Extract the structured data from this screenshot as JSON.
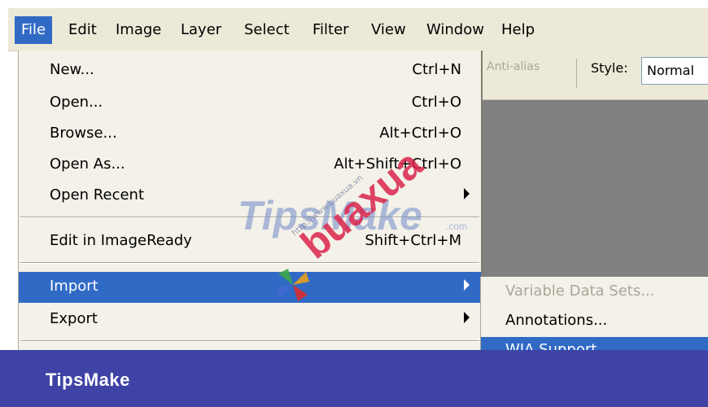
{
  "menubar": {
    "items": [
      "File",
      "Edit",
      "Image",
      "Layer",
      "Select",
      "Filter",
      "View",
      "Window",
      "Help"
    ],
    "active": "File"
  },
  "toolbar": {
    "anti_alias_label": "Anti-alias",
    "style_label": "Style:",
    "style_value": "Normal"
  },
  "file_menu": {
    "items": [
      {
        "label": "New...",
        "shortcut": "Ctrl+N"
      },
      {
        "label": "Open...",
        "shortcut": "Ctrl+O"
      },
      {
        "label": "Browse...",
        "shortcut": "Alt+Ctrl+O"
      },
      {
        "label": "Open As...",
        "shortcut": "Alt+Shift+Ctrl+O"
      },
      {
        "label": "Open Recent",
        "submenu": true
      },
      {
        "label": "Edit in ImageReady",
        "shortcut": "Shift+Ctrl+M"
      },
      {
        "label": "Import",
        "submenu": true,
        "highlighted": true
      },
      {
        "label": "Export",
        "submenu": true
      }
    ]
  },
  "import_submenu": {
    "items": [
      {
        "label": "Variable Data Sets...",
        "disabled": true
      },
      {
        "label": "Annotations..."
      },
      {
        "label": "WIA Support...",
        "highlighted": true
      }
    ]
  },
  "watermark": {
    "tipsmake": "TipsMake",
    "dotcom": ".com",
    "url": "http://www.buaxua.vn",
    "buaxua": "buaxua"
  },
  "banner": {
    "text": "TipsMake"
  },
  "colors": {
    "highlight": "#316ac5",
    "menu_bg": "#f3f1e8",
    "banner_bg": "#3e43a5",
    "canvas": "#808080"
  }
}
